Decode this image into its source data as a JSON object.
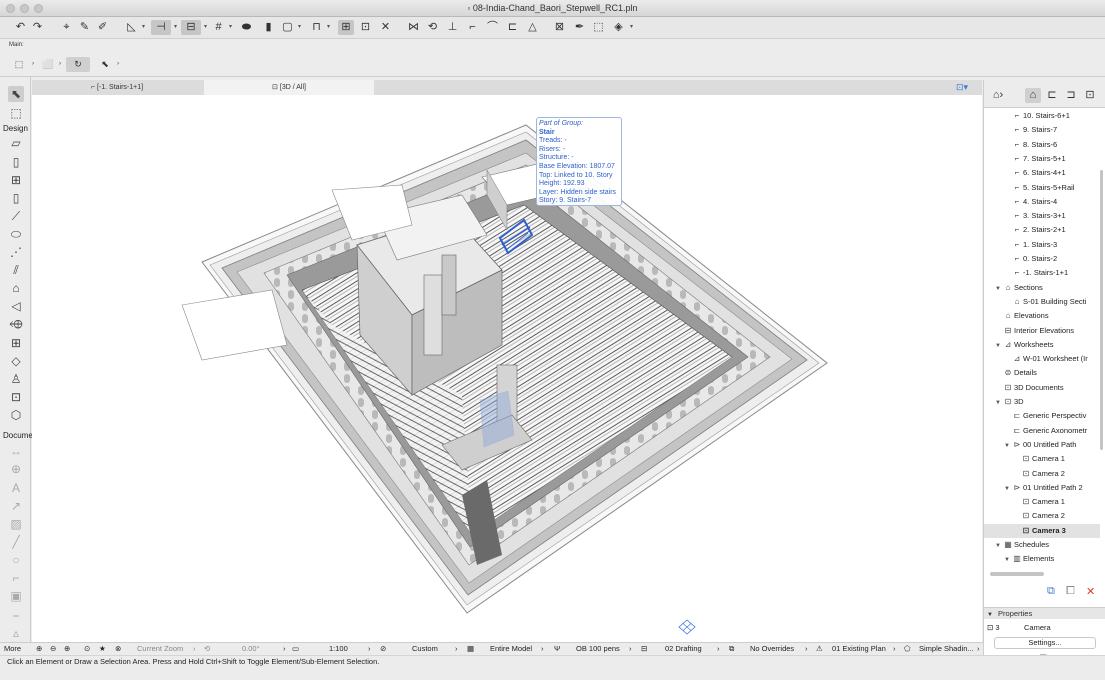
{
  "window": {
    "title": "08-India-Chand_Baori_Stepwell_RC1.pln"
  },
  "main_toolbar": {
    "label": "Main:"
  },
  "toolbox": {
    "section_design": "Design",
    "section_document": "Docume",
    "more": "More"
  },
  "tabs": [
    {
      "label": "[-1. Stairs-1+1]",
      "icon": "floor-plan-icon",
      "active": false
    },
    {
      "label": "[3D / All]",
      "icon": "camera-icon",
      "active": true
    }
  ],
  "tooltip": {
    "heading": "Part of Group:",
    "element": "Stair",
    "lines": [
      "Treads: -",
      "Risers: -",
      "Structure: -",
      "Base Elevation: 1807.07",
      "Top: Linked to 10. Story",
      "Height: 192.93",
      "Layer: Hidden side  stairs",
      "Story: 9. Stairs-7"
    ]
  },
  "navigator": {
    "items": [
      {
        "label": "10. Stairs-6+1",
        "icon": "story-icon",
        "level": 2
      },
      {
        "label": "9. Stairs-7",
        "icon": "story-icon",
        "level": 2
      },
      {
        "label": "8. Stairs-6",
        "icon": "story-icon",
        "level": 2
      },
      {
        "label": "7. Stairs-5+1",
        "icon": "story-icon",
        "level": 2
      },
      {
        "label": "6. Stairs-4+1",
        "icon": "story-icon",
        "level": 2
      },
      {
        "label": "5. Stairs-5+Rail",
        "icon": "story-icon",
        "level": 2
      },
      {
        "label": "4. Stairs-4",
        "icon": "story-icon",
        "level": 2
      },
      {
        "label": "3. Stairs-3+1",
        "icon": "story-icon",
        "level": 2
      },
      {
        "label": "2. Stairs-2+1",
        "icon": "story-icon",
        "level": 2
      },
      {
        "label": "1. Stairs-3",
        "icon": "story-icon",
        "level": 2
      },
      {
        "label": "0. Stairs-2",
        "icon": "story-icon",
        "level": 2
      },
      {
        "label": "-1. Stairs-1+1",
        "icon": "story-icon",
        "level": 2
      },
      {
        "label": "Sections",
        "icon": "section-icon",
        "level": 1,
        "expanded": true
      },
      {
        "label": "S-01 Building Secti",
        "icon": "section-icon",
        "level": 2
      },
      {
        "label": "Elevations",
        "icon": "elevation-icon",
        "level": 1
      },
      {
        "label": "Interior Elevations",
        "icon": "interior-elevation-icon",
        "level": 1
      },
      {
        "label": "Worksheets",
        "icon": "worksheet-icon",
        "level": 1,
        "expanded": true
      },
      {
        "label": "W-01 Worksheet (Ir",
        "icon": "worksheet-icon",
        "level": 2
      },
      {
        "label": "Details",
        "icon": "detail-icon",
        "level": 1
      },
      {
        "label": "3D Documents",
        "icon": "3d-document-icon",
        "level": 1
      },
      {
        "label": "3D",
        "icon": "3d-icon",
        "level": 1,
        "expanded": true
      },
      {
        "label": "Generic Perspectiv",
        "icon": "perspective-icon",
        "level": 2
      },
      {
        "label": "Generic Axonometr",
        "icon": "axonometry-icon",
        "level": 2
      },
      {
        "label": "00 Untitled Path",
        "icon": "path-icon",
        "level": 2,
        "expanded": true
      },
      {
        "label": "Camera 1",
        "icon": "camera-icon",
        "level": 3
      },
      {
        "label": "Camera 2",
        "icon": "camera-icon",
        "level": 3
      },
      {
        "label": "01 Untitled Path 2",
        "icon": "path-icon",
        "level": 2,
        "expanded": true
      },
      {
        "label": "Camera 1",
        "icon": "camera-icon",
        "level": 3
      },
      {
        "label": "Camera 2",
        "icon": "camera-icon",
        "level": 3
      },
      {
        "label": "Camera 3",
        "icon": "camera-icon",
        "level": 3,
        "selected": true
      },
      {
        "label": "Schedules",
        "icon": "schedule-icon",
        "level": 1,
        "expanded": true
      },
      {
        "label": "Elements",
        "icon": "elements-icon",
        "level": 2,
        "expanded": true
      }
    ]
  },
  "properties": {
    "header": "Properties",
    "id": "3",
    "type": "Camera",
    "settings_label": "Settings..."
  },
  "bottom_bar": {
    "zoom_label": "Current Zoom",
    "angle": "0.00°",
    "scale": "1:100",
    "layer_combo": "Custom",
    "model_view": "Entire Model",
    "pen_set": "OB 100 pens",
    "mvo": "02 Drafting",
    "overrides": "No Overrides",
    "renovation": "01 Existing Plan",
    "shading": "Simple Shadin..."
  },
  "status": {
    "text": "Click an Element or Draw a Selection Area. Press and Hold Ctrl+Shift to Toggle Element/Sub-Element Selection."
  },
  "colors": {
    "accent": "#2e63c8",
    "selection": "#3a6fd8"
  }
}
